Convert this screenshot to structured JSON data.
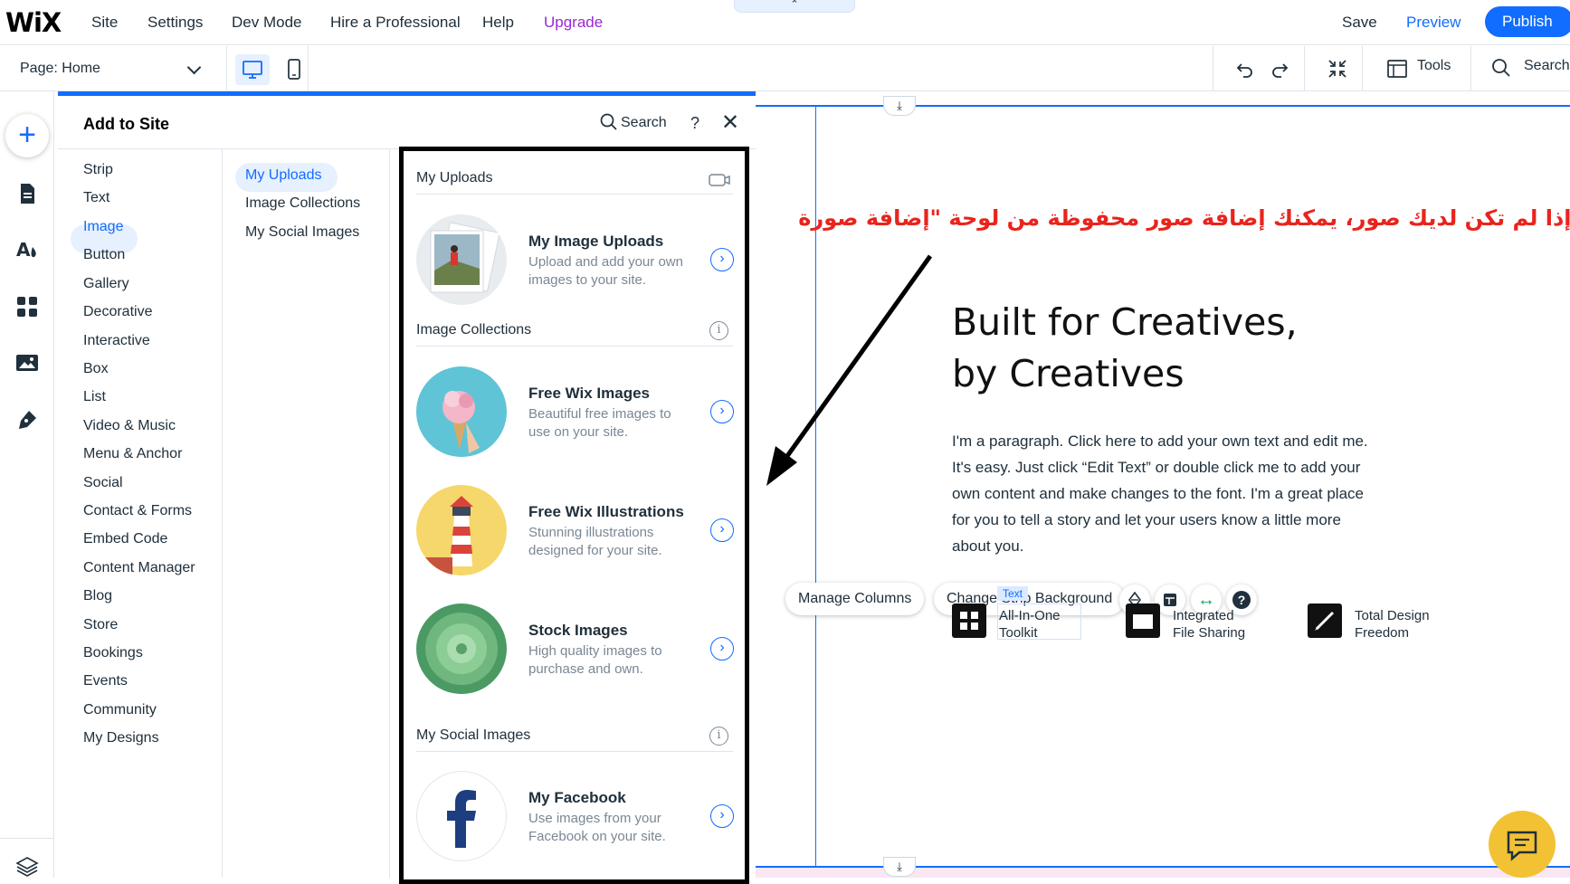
{
  "topbar": {
    "logo": "WiX",
    "menu": [
      "Site",
      "Settings",
      "Dev Mode",
      "Hire a Professional",
      "Help",
      "Upgrade"
    ],
    "handle_glyph": "⌃",
    "save": "Save",
    "preview": "Preview",
    "publish": "Publish"
  },
  "toolbar": {
    "page_label": "Page: Home",
    "tools": "Tools",
    "search": "Search"
  },
  "panel": {
    "title": "Add to Site",
    "search": "Search",
    "help": "?",
    "close": "✕",
    "categories": [
      "Strip",
      "Text",
      "Image",
      "Button",
      "Gallery",
      "Decorative",
      "Interactive",
      "Box",
      "List",
      "Video & Music",
      "Menu & Anchor",
      "Social",
      "Contact & Forms",
      "Embed Code",
      "Content Manager",
      "Blog",
      "Store",
      "Bookings",
      "Events",
      "Community",
      "My Designs"
    ],
    "selected_category": "Image",
    "subcategories": [
      "My Uploads",
      "Image Collections",
      "My Social Images"
    ],
    "selected_subcategory": "My Uploads",
    "sections": {
      "my_uploads": "My Uploads",
      "image_collections": "Image Collections",
      "my_social_images": "My Social Images"
    },
    "cards": [
      {
        "title": "My Image Uploads",
        "desc": "Upload and add your own images to your site."
      },
      {
        "title": "Free Wix Images",
        "desc": "Beautiful free images to use on your site."
      },
      {
        "title": "Free Wix Illustrations",
        "desc": "Stunning illustrations designed for your site."
      },
      {
        "title": "Stock Images",
        "desc": "High quality images to purchase and own."
      },
      {
        "title": "My Facebook",
        "desc": "Use images from your Facebook on your site."
      }
    ]
  },
  "canvas": {
    "annotation": "\"إذا لم تكن لديك صور، يمكنك إضافة صور محفوظة من لوحة \"إضافة صورة",
    "heading_line1": "Built for Creatives,",
    "heading_line2": "by Creatives",
    "paragraph": "I'm a paragraph. Click here to add your own text and edit me. It's easy. Just click “Edit Text” or double click me to add your own content and make changes to the font. I'm a great place for you to tell a story and let your users know a little more about you.",
    "manage_columns": "Manage Columns",
    "change_strip_bg": "Change Strip Background",
    "help_glyph": "?",
    "text_tag": "Text",
    "features": [
      {
        "line1": "All-In-One",
        "line2": "Toolkit"
      },
      {
        "line1": "Integrated",
        "line2": "File Sharing"
      },
      {
        "line1": "Total Design",
        "line2": "Freedom"
      }
    ]
  },
  "colors": {
    "accent": "#116dff",
    "upgrade": "#9a27d5",
    "annotation": "#e8241c",
    "selected_bg": "#e7f0ff",
    "chat": "#f2c234"
  }
}
